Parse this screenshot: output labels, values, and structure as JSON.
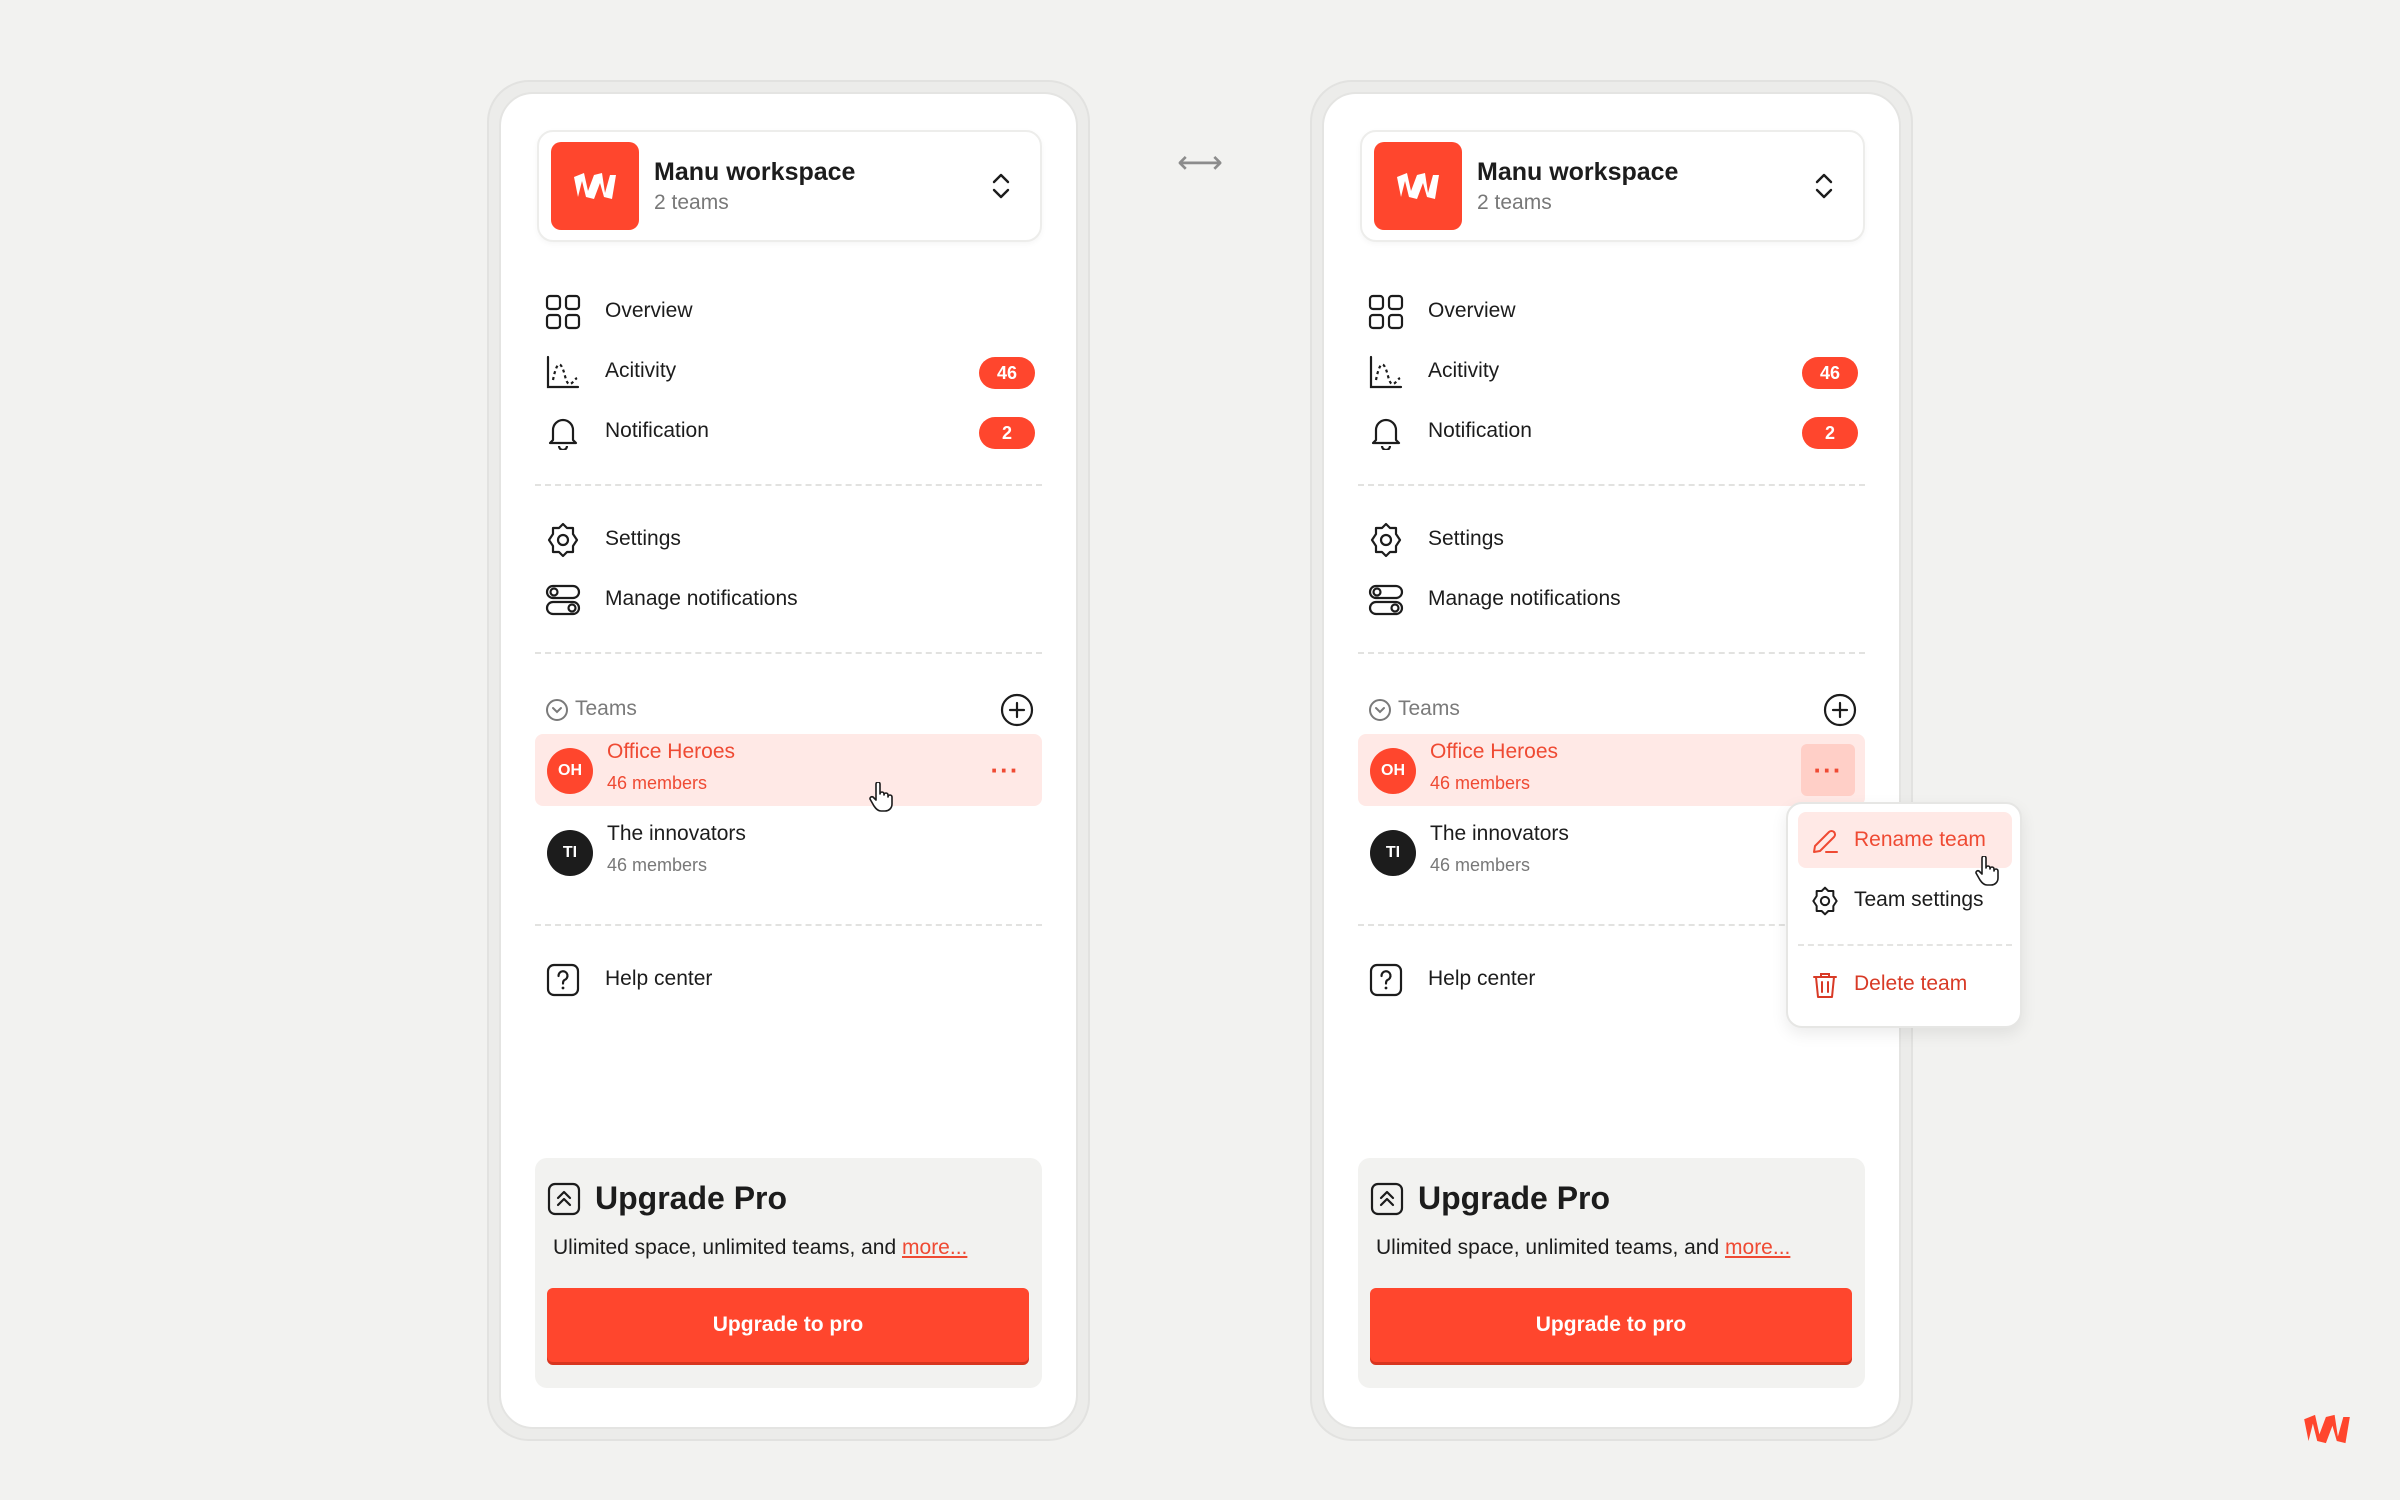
{
  "workspace": {
    "name": "Manu workspace",
    "teams_count": "2 teams"
  },
  "nav": {
    "overview": "Overview",
    "activity": "Acitivity",
    "activity_badge": "46",
    "notification": "Notification",
    "notification_badge": "2",
    "settings": "Settings",
    "manage_notifications": "Manage notifications",
    "help": "Help center"
  },
  "teams": {
    "header": "Teams",
    "items": [
      {
        "initials": "OH",
        "name": "Office Heroes",
        "members": "46 members",
        "avatar_color": "#ff462d"
      },
      {
        "initials": "TI",
        "name": "The innovators",
        "members": "46 members",
        "avatar_color": "#1c1c1c"
      }
    ],
    "more_label": "···"
  },
  "upgrade": {
    "title": "Upgrade Pro",
    "desc": "Ulimited space, unlimited teams, and",
    "more_link": "more...",
    "button": "Upgrade to pro"
  },
  "context_menu": {
    "rename": "Rename team",
    "settings": "Team settings",
    "delete": "Delete team"
  },
  "transition_arrow": "⟷",
  "colors": {
    "accent": "#ff462d",
    "accent_soft": "#ffe9e6",
    "danger_text": "#d83a26"
  }
}
